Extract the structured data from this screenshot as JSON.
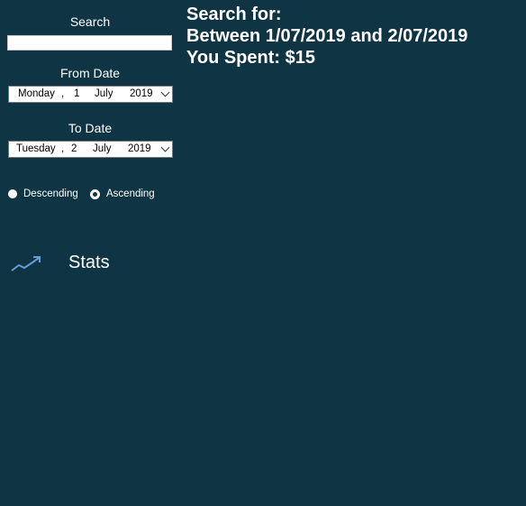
{
  "sidebar": {
    "search_label": "Search",
    "search_value": "",
    "from_label": "From Date",
    "from_date": {
      "weekday": "Monday",
      "sep": ",",
      "day": "1",
      "month": "July",
      "year": "2019"
    },
    "to_label": "To Date",
    "to_date": {
      "weekday": "Tuesday",
      "sep": ",",
      "day": "2",
      "month": "July",
      "year": "2019"
    },
    "sort_options": [
      {
        "label": "Descending",
        "checked": false
      },
      {
        "label": "Ascending",
        "checked": true
      }
    ],
    "stats_label": "Stats",
    "stats_icon": "trending-up-icon"
  },
  "results": {
    "line1": "Search for:",
    "line2": "Between 1/07/2019 and 2/07/2019",
    "line3": "You Spent: $15"
  },
  "colors": {
    "background": "#0f3443",
    "text": "#ffffff",
    "icon": "#5f9fd6"
  }
}
